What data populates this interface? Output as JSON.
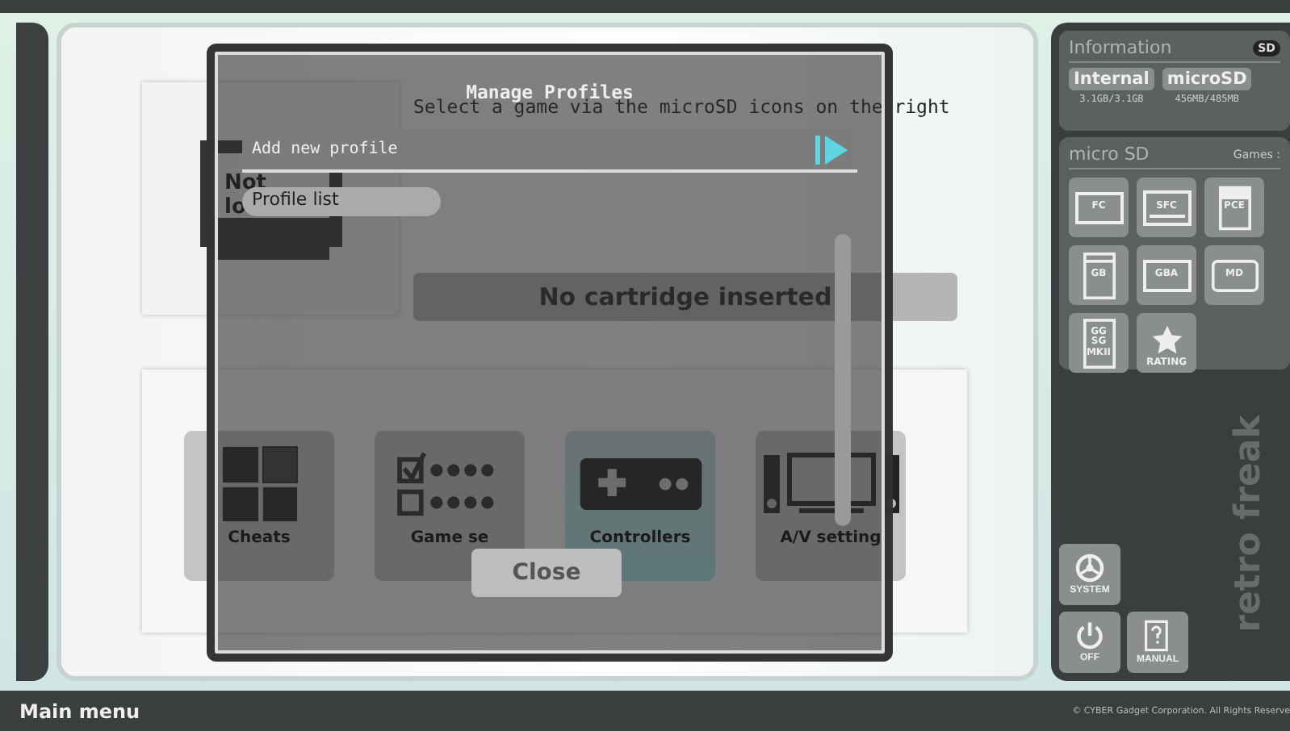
{
  "game_panel": {
    "card_label_lines": [
      "Not",
      "lo"
    ],
    "instruction": "Select a game via the microSD icons on the right",
    "cartridge_status": "No cartridge inserted"
  },
  "menu_tiles": [
    {
      "label": "Cheats",
      "kind": "cheats",
      "selected": false
    },
    {
      "label": "Game se",
      "kind": "settings",
      "selected": false
    },
    {
      "label": "Controllers",
      "kind": "controllers",
      "selected": true
    },
    {
      "label": "A/V setting",
      "kind": "av",
      "selected": false
    }
  ],
  "information": {
    "title": "Information",
    "sd_badge": "SD",
    "storage": [
      {
        "label": "Internal",
        "usage": "3.1GB/3.1GB"
      },
      {
        "label": "microSD",
        "usage": "456MB/485MB"
      }
    ]
  },
  "micro_sd": {
    "title": "micro SD",
    "games_label": "Games :",
    "systems": [
      {
        "lines": [
          "FC"
        ],
        "kind": "wide"
      },
      {
        "lines": [
          "SFC"
        ],
        "kind": "snes"
      },
      {
        "lines": [
          "PCE"
        ],
        "kind": "card"
      },
      {
        "lines": [
          "GB"
        ],
        "kind": "handheld"
      },
      {
        "lines": [
          "GBA"
        ],
        "kind": "wide"
      },
      {
        "lines": [
          "MD"
        ],
        "kind": "md"
      },
      {
        "lines": [
          "GG",
          "SG",
          "MKII"
        ],
        "kind": "tall"
      },
      {
        "lines": [
          "RATING"
        ],
        "kind": "rating"
      }
    ]
  },
  "system_buttons": [
    {
      "label": "SYSTEM",
      "kind": "system"
    },
    {
      "label": "OFF",
      "kind": "power"
    },
    {
      "label": "MANUAL",
      "kind": "manual"
    }
  ],
  "logo": "retro freak",
  "dialog": {
    "title": "Manage Profiles",
    "items": [
      {
        "label": "Add new profile",
        "kind": "action"
      },
      {
        "label": "Profile list",
        "kind": "pill"
      }
    ],
    "close": "Close"
  },
  "status_bar": {
    "title": "Main menu",
    "copyright": "© CYBER Gadget Corporation. All Rights Reserve"
  }
}
